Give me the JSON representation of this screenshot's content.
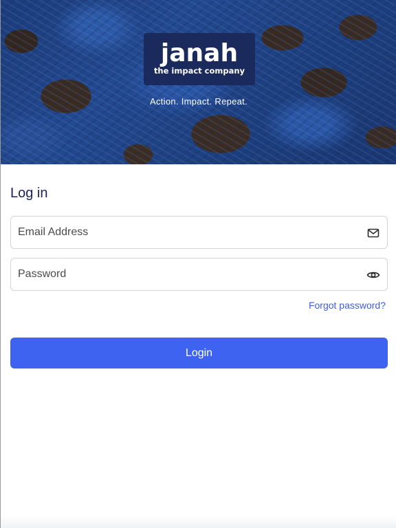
{
  "hero": {
    "logo_word": "janah",
    "logo_sub": "the impact company",
    "tagline": "Action. Impact. Repeat."
  },
  "form": {
    "title": "Log in",
    "email": {
      "placeholder": "Email Address",
      "value": "",
      "icon": "mail-icon"
    },
    "password": {
      "placeholder": "Password",
      "value": "",
      "icon": "eye-icon"
    },
    "forgot_label": "Forgot password?",
    "login_label": "Login"
  },
  "colors": {
    "title": "#1b1f5e",
    "accent": "#3e63f0",
    "link": "#3d5fe0",
    "logo_bg": "#1a2a5c"
  }
}
